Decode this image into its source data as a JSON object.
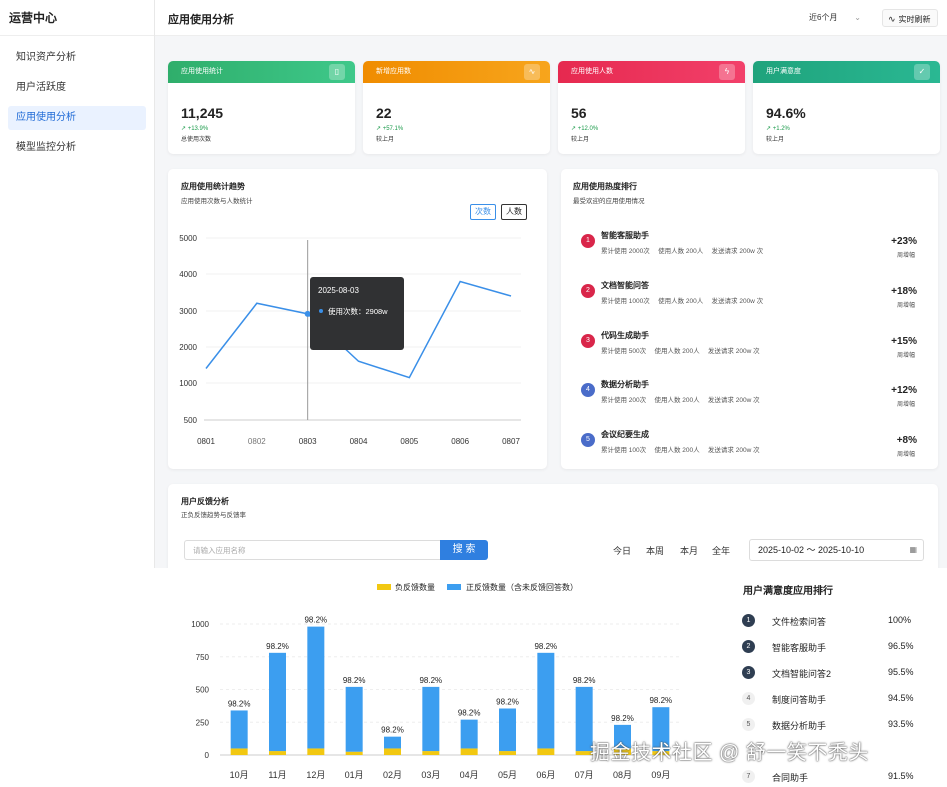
{
  "sidebar": {
    "brand": "运营中心",
    "items": [
      {
        "label": "知识资产分析",
        "active": false
      },
      {
        "label": "用户活跃度",
        "active": false
      },
      {
        "label": "应用使用分析",
        "active": true
      },
      {
        "label": "模型监控分析",
        "active": false
      }
    ]
  },
  "header": {
    "title": "应用使用分析",
    "range": "近6个月",
    "refresh": "实时刷新"
  },
  "stats": [
    {
      "title": "应用使用统计",
      "value": "11,245",
      "change": "+13.9%",
      "sub": "总使用次数",
      "color": "#2fae6b",
      "icon": "▯"
    },
    {
      "title": "新增应用数",
      "value": "22",
      "change": "+57.1%",
      "sub": "较上月",
      "color": "#f08c00",
      "icon": "∿"
    },
    {
      "title": "应用使用人数",
      "value": "56",
      "change": "+12.0%",
      "sub": "较上月",
      "color": "#e6294f",
      "icon": "ϟ"
    },
    {
      "title": "用户满意度",
      "value": "94.6%",
      "change": "+1.2%",
      "sub": "较上月",
      "color": "#1fa37c",
      "icon": "👍"
    }
  ],
  "trend": {
    "title": "应用使用统计趋势",
    "subtitle": "应用使用次数与人数统计",
    "toggle_count": "次数",
    "toggle_people": "人数",
    "tooltip_date": "2025-08-03",
    "tooltip_value": "使用次数：2908w"
  },
  "hot": {
    "title": "应用使用热度排行",
    "subtitle": "最受欢迎的应用使用情况",
    "week_label": "周增幅",
    "items": [
      {
        "rank": "1",
        "name": "智能客服助手",
        "meta": "累计使用 2000次　 使用人数  200人　 发送请求 200w 次",
        "pct": "+23%",
        "color": "#d9264a"
      },
      {
        "rank": "2",
        "name": "文档智能问答",
        "meta": "累计使用 1000次　 使用人数  200人　 发送请求 200w 次",
        "pct": "+18%",
        "color": "#d9264a"
      },
      {
        "rank": "3",
        "name": "代码生成助手",
        "meta": "累计使用 500次　 使用人数  200人　 发送请求 200w 次",
        "pct": "+15%",
        "color": "#d9264a"
      },
      {
        "rank": "4",
        "name": "数据分析助手",
        "meta": "累计使用 200次　 使用人数  200人　 发送请求 200w 次",
        "pct": "+12%",
        "color": "#4a6cc9"
      },
      {
        "rank": "5",
        "name": "会议纪要生成",
        "meta": "累计使用 100次　 使用人数  200人　 发送请求 200w 次",
        "pct": "+8%",
        "color": "#4a6cc9"
      }
    ]
  },
  "feedback": {
    "title": "用户反馈分析",
    "subtitle": "正负反馈趋势与反馈率",
    "search_placeholder": "请输入应用名称",
    "search_button": "搜 索",
    "quick": [
      "今日",
      "本周",
      "本月",
      "全年"
    ],
    "date_range": "2025-10-02  ～ 2025-10-10",
    "legend_neg": "负反馈数量",
    "legend_pos": "正反馈数量（含未反馈回答数）",
    "sat_title": "用户满意度应用排行",
    "sat_items": [
      {
        "rank": "1",
        "name": "文件检索问答",
        "pct": "100%"
      },
      {
        "rank": "2",
        "name": "智能客服助手",
        "pct": "96.5%"
      },
      {
        "rank": "3",
        "name": "文档智能问答2",
        "pct": "95.5%"
      },
      {
        "rank": "4",
        "name": "制度问答助手",
        "pct": "94.5%"
      },
      {
        "rank": "5",
        "name": "数据分析助手",
        "pct": "93.5%"
      },
      {
        "rank": "7",
        "name": "合同助手",
        "pct": "91.5%"
      }
    ]
  },
  "watermark": "掘金技术社区 @ 舒一笑不秃头",
  "chart_data": [
    {
      "type": "line",
      "x": [
        "0801",
        "0802",
        "0803",
        "0804",
        "0805",
        "0806",
        "0807"
      ],
      "xlabels_shown": [
        "0801",
        "0802",
        "0803",
        "0804",
        "0805",
        "0806",
        "0807"
      ],
      "values": [
        1400,
        3200,
        2908,
        1600,
        1150,
        3800,
        3400
      ],
      "yticks": [
        500,
        1000,
        2000,
        3000,
        4000,
        5000
      ],
      "ylim": [
        0,
        5000
      ],
      "highlight_index": 2,
      "color": "#3a8fe8"
    },
    {
      "type": "bar",
      "categories": [
        "10月",
        "11月",
        "12月",
        "01月",
        "02月",
        "03月",
        "04月",
        "05月",
        "06月",
        "07月",
        "08月",
        "09月"
      ],
      "series": [
        {
          "name": "负反馈数量",
          "values": [
            50,
            30,
            50,
            25,
            50,
            30,
            50,
            30,
            50,
            30,
            50,
            30
          ],
          "color": "#f2c811"
        },
        {
          "name": "正反馈数量（含未反馈回答数）",
          "values": [
            290,
            750,
            930,
            495,
            90,
            490,
            220,
            325,
            730,
            490,
            180,
            335
          ],
          "color": "#3c9ef0"
        }
      ],
      "labels": [
        "98.2%",
        "98.2%",
        "98.2%",
        "98.2%",
        "98.2%",
        "98.2%",
        "98.2%",
        "98.2%",
        "98.2%",
        "98.2%",
        "98.2%",
        "98.2%"
      ],
      "yticks": [
        0,
        250,
        500,
        750,
        1000
      ],
      "ylim": [
        0,
        1000
      ]
    }
  ]
}
